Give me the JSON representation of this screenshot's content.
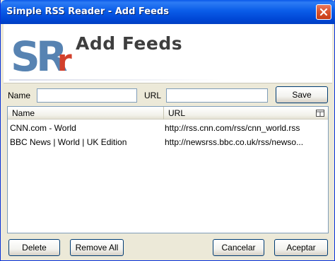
{
  "window": {
    "title": "Simple RSS Reader - Add Feeds"
  },
  "banner": {
    "logo_text": "SRr",
    "title": "Add Feeds"
  },
  "form": {
    "name_label": "Name",
    "name_value": "",
    "url_label": "URL",
    "url_value": "",
    "save_label": "Save"
  },
  "list": {
    "columns": [
      "Name",
      "URL"
    ],
    "rows": [
      {
        "name": "CNN.com - World",
        "url": "http://rss.cnn.com/rss/cnn_world.rss"
      },
      {
        "name": "BBC News | World | UK Edition",
        "url": "http://newsrss.bbc.co.uk/rss/newso..."
      }
    ]
  },
  "buttons": {
    "delete": "Delete",
    "remove_all": "Remove All",
    "cancel": "Cancelar",
    "accept": "Aceptar"
  },
  "colors": {
    "title_bar": "#0a5ce8",
    "logo_blue": "#3a6ea5",
    "logo_red": "#d2402c"
  }
}
